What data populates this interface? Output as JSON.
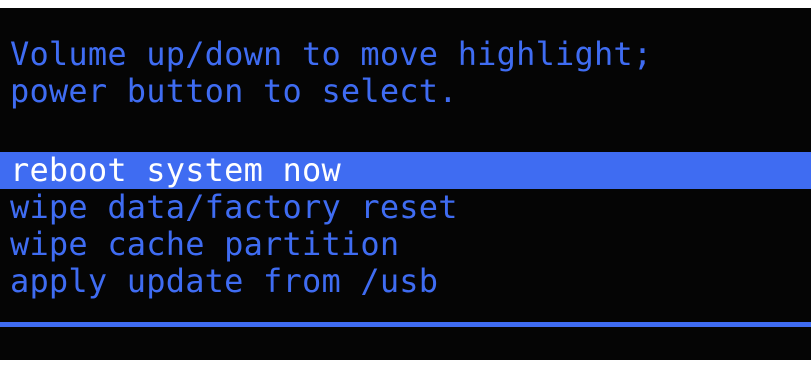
{
  "header": {
    "line1": "Volume up/down to move highlight;",
    "line2": "power button to select."
  },
  "menu": {
    "items": [
      {
        "label": "reboot system now",
        "selected": true
      },
      {
        "label": "wipe data/factory reset",
        "selected": false
      },
      {
        "label": "wipe cache partition",
        "selected": false
      },
      {
        "label": "apply update from /usb",
        "selected": false
      }
    ]
  },
  "colors": {
    "background": "#050505",
    "text": "#3f6cf2",
    "highlight": "#3f6cf2",
    "highlight_text": "#ffffff"
  }
}
